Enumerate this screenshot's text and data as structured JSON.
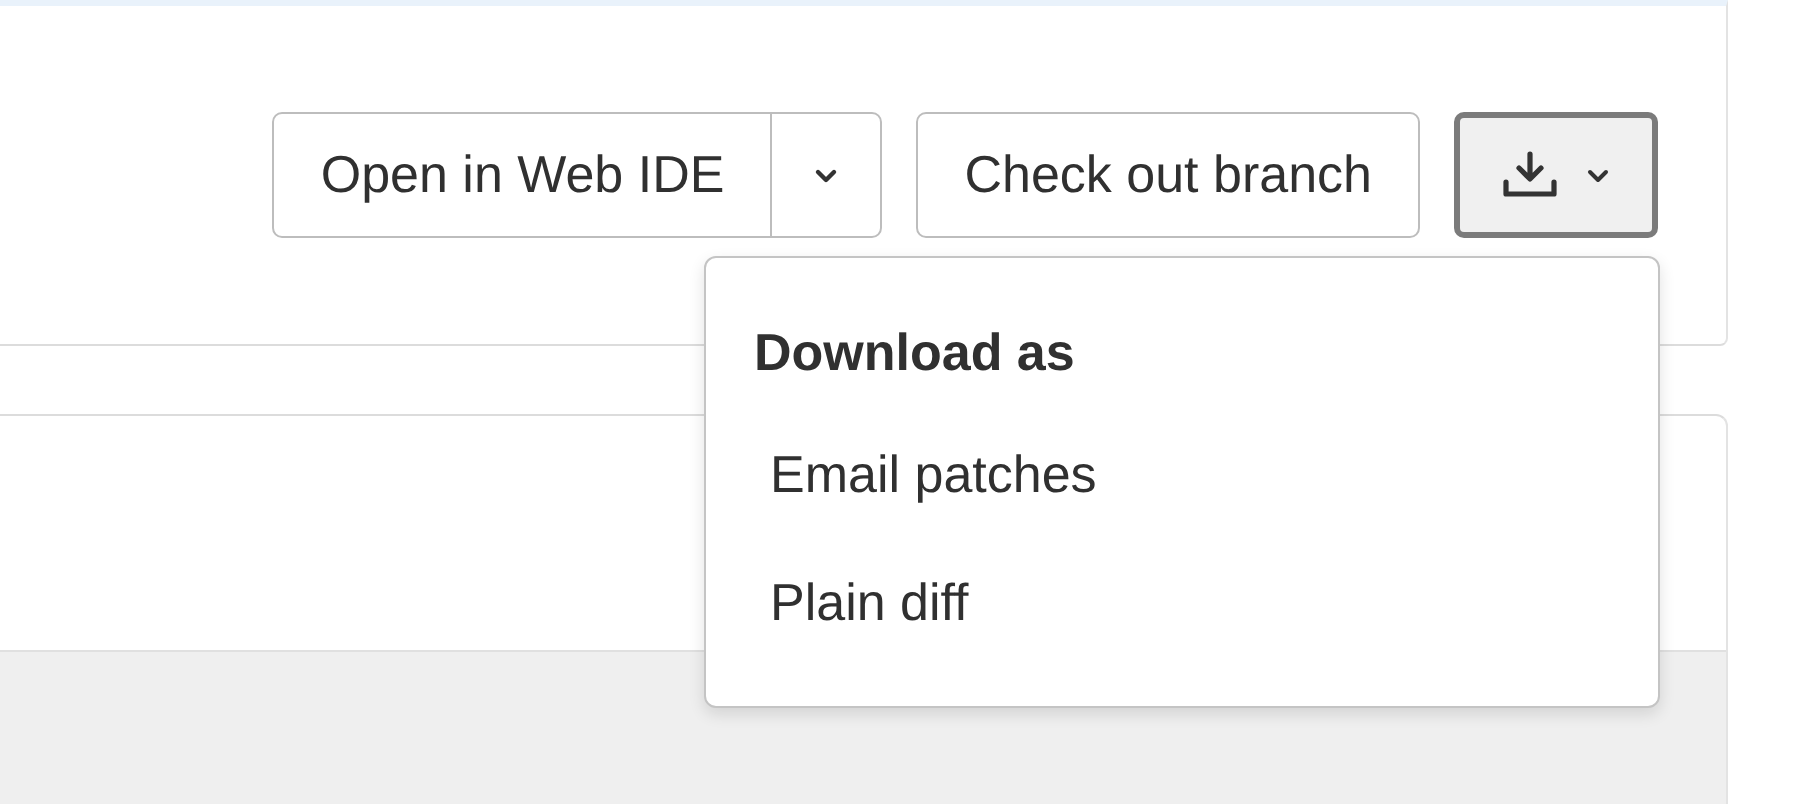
{
  "toolbar": {
    "web_ide_button": {
      "label": "Open in Web IDE"
    },
    "checkout_button": {
      "label": "Check out branch"
    },
    "download_button": {
      "expanded": true
    }
  },
  "download_menu": {
    "heading": "Download as",
    "items": [
      {
        "label": "Email patches"
      },
      {
        "label": "Plain diff"
      }
    ]
  }
}
